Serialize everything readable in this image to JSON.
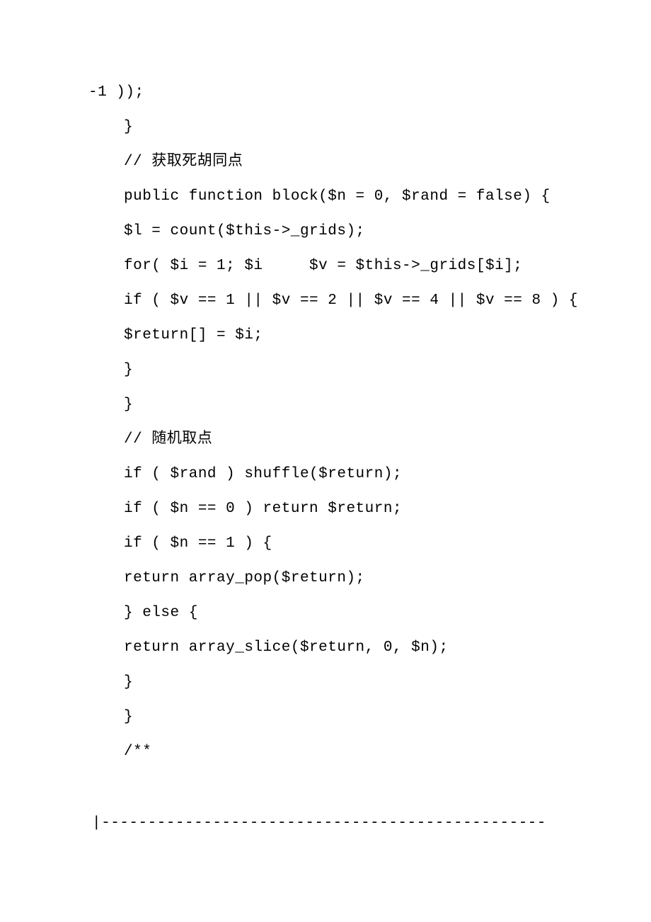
{
  "code": {
    "lines": [
      "-1 ));",
      "}",
      "// 获取死胡同点",
      "public function block($n = 0, $rand = false) {",
      "$l = count($this->_grids);",
      "for( $i = 1; $i     $v = $this->_grids[$i];",
      "if ( $v == 1 || $v == 2 || $v == 4 || $v == 8 ) {",
      "$return[] = $i;",
      "}",
      "}",
      "// 随机取点",
      "if ( $rand ) shuffle($return);",
      "if ( $n == 0 ) return $return;",
      "if ( $n == 1 ) {",
      "return array_pop($return);",
      "} else {",
      "return array_slice($return, 0, $n);",
      "}",
      "}",
      "/**"
    ],
    "separator": "|------------------------------------------------"
  }
}
